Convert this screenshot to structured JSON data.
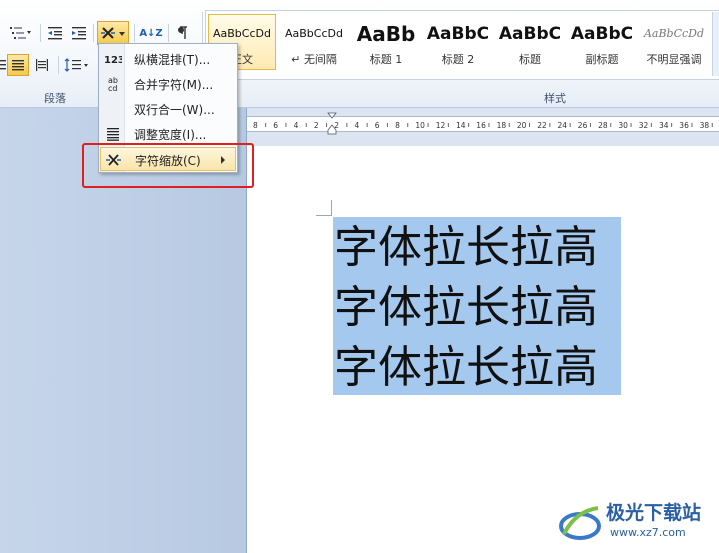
{
  "ribbon": {
    "paragraph_group_label": "段落",
    "styles_group_label": "样式",
    "sort_label": "A↓Z",
    "styles": [
      {
        "sample": "AaBbCcDd",
        "name": "正文",
        "selected": true
      },
      {
        "sample": "AaBbCcDd",
        "name": "↵ 无间隔",
        "selected": false
      },
      {
        "sample": "AaBb",
        "name": "标题 1",
        "selected": false
      },
      {
        "sample": "AaBbC",
        "name": "标题 2",
        "selected": false
      },
      {
        "sample": "AaBbC",
        "name": "标题",
        "selected": false
      },
      {
        "sample": "AaBbC",
        "name": "副标题",
        "selected": false
      },
      {
        "sample": "AaBbCcDd",
        "name": "不明显强调",
        "selected": false
      }
    ]
  },
  "menu": {
    "items": [
      {
        "icon": "vertical-horizontal-icon",
        "label": "纵横混排(T)..."
      },
      {
        "icon": "combine-characters-icon",
        "label": "合并字符(M)..."
      },
      {
        "icon": "two-lines-in-one-icon",
        "label": "双行合一(W)..."
      },
      {
        "icon": "fit-text-icon",
        "label": "调整宽度(I)..."
      },
      {
        "icon": "character-scaling-icon",
        "label": "字符缩放(C)"
      }
    ]
  },
  "ruler": {
    "ticks": [
      "8",
      "6",
      "4",
      "2",
      "2",
      "4",
      "6",
      "8",
      "10",
      "12",
      "14",
      "16",
      "18",
      "20",
      "22",
      "24",
      "26",
      "28",
      "30",
      "32",
      "34",
      "36",
      "38"
    ]
  },
  "document": {
    "lines": [
      "字体拉长拉高",
      "字体拉长拉高",
      "字体拉长拉高"
    ]
  },
  "watermark": {
    "title": "极光下载站",
    "url": "www.xz7.com"
  }
}
